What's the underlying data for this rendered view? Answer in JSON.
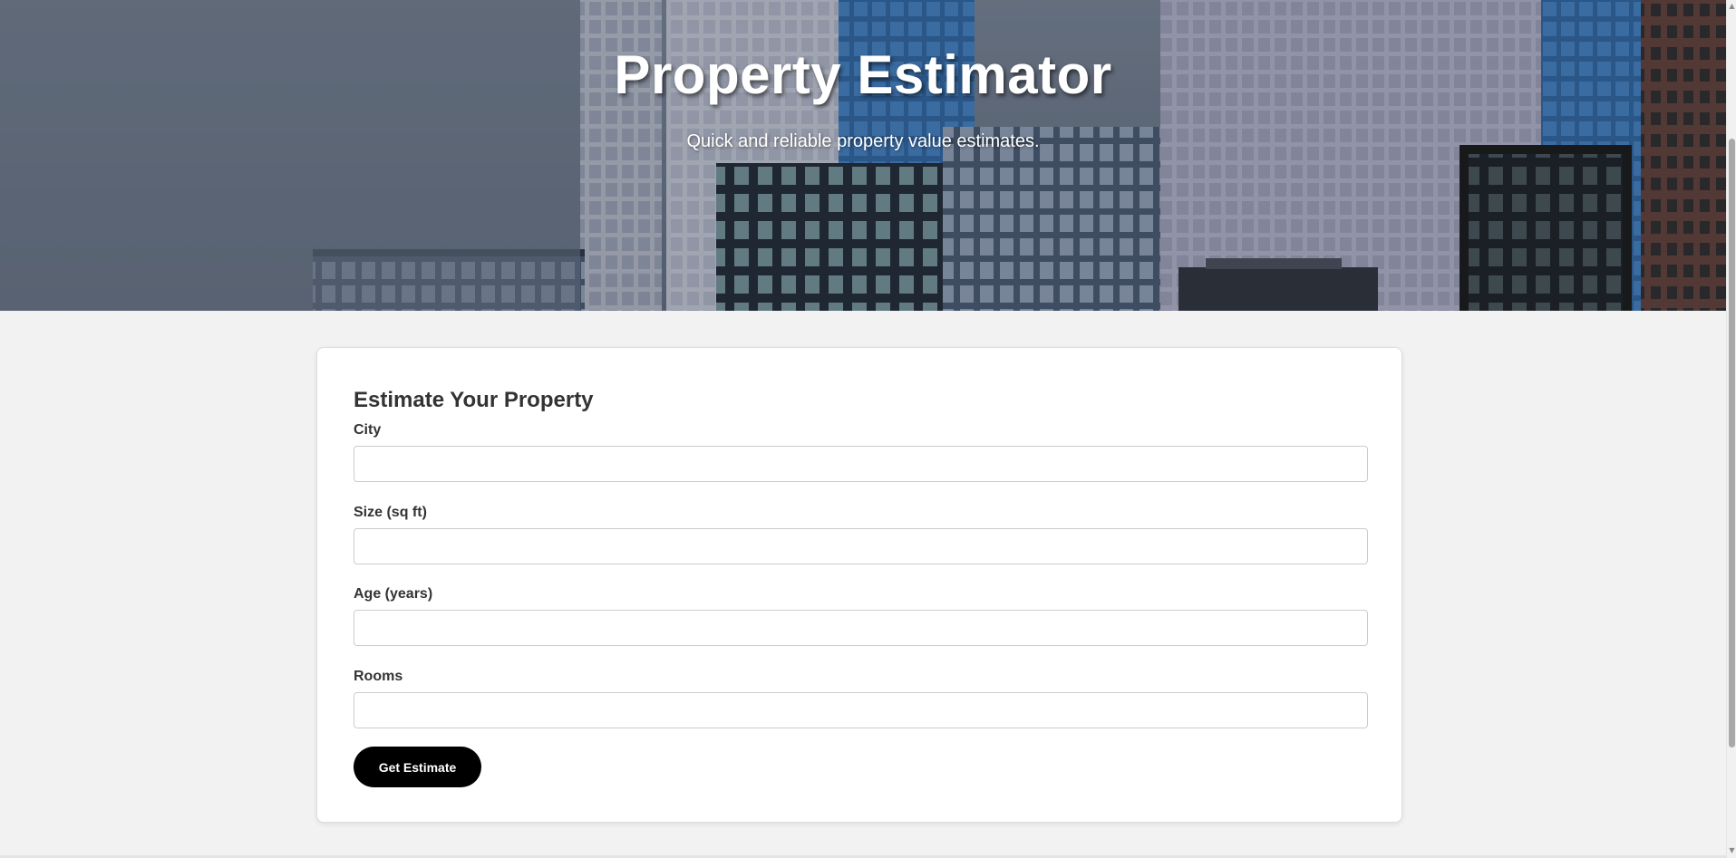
{
  "hero": {
    "title": "Property Estimator",
    "subtitle": "Quick and reliable property value estimates."
  },
  "form": {
    "title": "Estimate Your Property",
    "fields": [
      {
        "label": "City",
        "value": "",
        "placeholder": ""
      },
      {
        "label": "Size (sq ft)",
        "value": "",
        "placeholder": ""
      },
      {
        "label": "Age (years)",
        "value": "",
        "placeholder": ""
      },
      {
        "label": "Rooms",
        "value": "",
        "placeholder": ""
      }
    ],
    "submit_label": "Get Estimate"
  },
  "scrollbar": {
    "up_icon": "triangle-up-icon",
    "down_icon": "triangle-down-icon"
  },
  "colors": {
    "page_background": "#f2f2f2",
    "card_background": "#ffffff",
    "button_background": "#000000",
    "button_text": "#ffffff",
    "heading_text": "#333333"
  }
}
